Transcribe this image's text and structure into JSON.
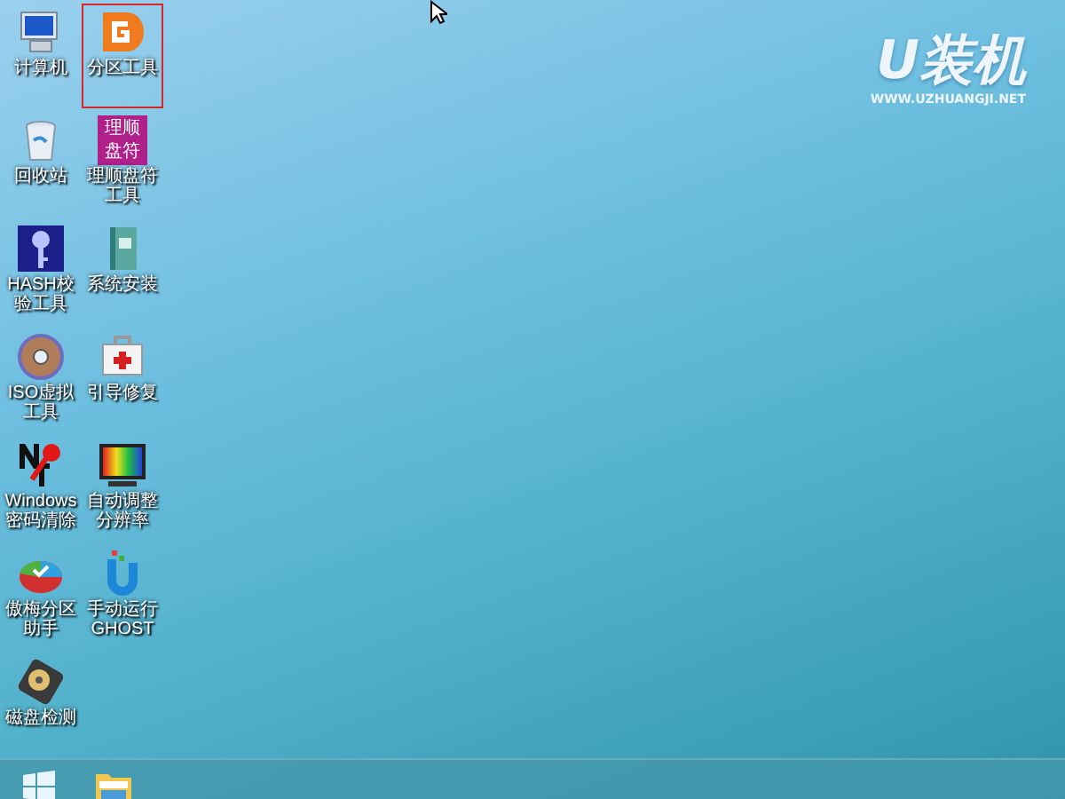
{
  "desktop": {
    "icons": [
      {
        "label": "计算机",
        "kind": "computer",
        "selected": false
      },
      {
        "label": "回收站",
        "kind": "recycle",
        "selected": false
      },
      {
        "label": "HASH校验工具",
        "kind": "key",
        "selected": false
      },
      {
        "label": "ISO虚拟工具",
        "kind": "disc",
        "selected": false
      },
      {
        "label": "Windows密码清除",
        "kind": "ntkey",
        "selected": false
      },
      {
        "label": "傲梅分区助手",
        "kind": "pie",
        "selected": false
      },
      {
        "label": "磁盘检测",
        "kind": "disk",
        "selected": false
      },
      {
        "label": "分区工具",
        "kind": "partition",
        "selected": true
      },
      {
        "label": "理顺盘符工具",
        "kind": "tile",
        "icon_text": [
          "理顺",
          "盘符"
        ],
        "selected": false
      },
      {
        "label": "系统安装",
        "kind": "book",
        "selected": false
      },
      {
        "label": "引导修复",
        "kind": "medkit",
        "selected": false
      },
      {
        "label": "自动调整分辨率",
        "kind": "monitor",
        "selected": false
      },
      {
        "label": "手动运行GHOST",
        "kind": "ghost",
        "selected": false
      }
    ]
  },
  "wallpaper_logo": {
    "mark": "U装机",
    "url": "WWW.UZHUANGJI.NET"
  },
  "taskbar": {
    "buttons": [
      {
        "kind": "start"
      },
      {
        "kind": "explorer"
      }
    ]
  }
}
